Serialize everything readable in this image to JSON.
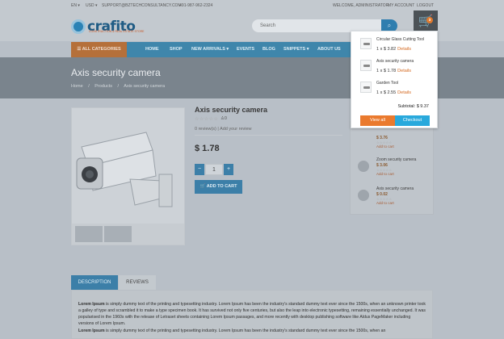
{
  "topbar": {
    "lang": "EN ▾",
    "currency": "USD ▾",
    "email": "SUPPORT@BZTECHCONSULTANCY.COM",
    "phone": "+91-987-962-2324",
    "welcome": "WELCOME, ADMINISTRATOR",
    "my_account": "MY ACCOUNT",
    "logout": "LOGOUT"
  },
  "header": {
    "logo": "crafito",
    "tagline": "CONSTRUCTION & REAL ESTATE STORE",
    "search_placeholder": "Search"
  },
  "nav": {
    "all_categories": "☰ ALL CATEGORIES",
    "items": [
      "HOME",
      "SHOP",
      "NEW ARRIVALS ▾",
      "EVENTS",
      "BLOG",
      "SNIPPETS ▾",
      "ABOUT US"
    ]
  },
  "banner": {
    "title": "Axis security camera",
    "crumbs": [
      "Home",
      "/",
      "Products",
      "/",
      "Axis security camera"
    ]
  },
  "product": {
    "title": "Axis security camera",
    "stars": "☆☆☆☆☆",
    "likes": "♙0",
    "reviews": "0 review(s) | Add your review",
    "price": "$ 1.78",
    "qty": "1",
    "qty_minus": "−",
    "qty_plus": "+",
    "add_to_cart": "🛒 ADD TO CART"
  },
  "sidebar": {
    "items": [
      {
        "name": "",
        "price": "$ 3.76",
        "stars": "☆☆☆☆☆",
        "add": "Add to cart"
      },
      {
        "name": "Zoom security camera",
        "price": "$ 3.06",
        "stars": "☆☆☆☆☆",
        "add": "Add to cart"
      },
      {
        "name": "Axis security camera",
        "price": "$ 0.02",
        "stars": "☆☆☆☆☆",
        "add": "Add to cart"
      }
    ]
  },
  "tabs": {
    "description": "DESCRIPTION",
    "reviews": "REVIEWS"
  },
  "description": {
    "lead1": "Lorem Ipsum",
    "text1": " is simply dummy text of the printing and typesetting industry. Lorem Ipsum has been the industry's standard dummy text ever since the 1500s, when an unknown printer took a galley of type and scrambled it to make a type specimen book. It has survived not only five centuries, but also the leap into electronic typesetting, remaining essentially unchanged. It was popularised in the 1960s with the release of Letraset sheets containing Lorem Ipsum passages, and more recently with desktop publishing software like Aldus PageMaker including versions of Lorem Ipsum.",
    "lead2": "Lorem Ipsum",
    "text2": " is simply dummy text of the printing and typesetting industry. Lorem Ipsum has been the industry's standard dummy text ever since the 1500s, when an"
  },
  "cart": {
    "count": "3",
    "items": [
      {
        "name": "Circular Glass Cutting Tool",
        "qty_price": "1 x $ 3.82",
        "details": "Details"
      },
      {
        "name": "Axis security camera",
        "qty_price": "1 x $ 1.78",
        "details": "Details"
      },
      {
        "name": "Garden Tool",
        "qty_price": "1 x $ 2.55",
        "details": "Details"
      }
    ],
    "subtotal_label": "Subtotal:",
    "subtotal": "$ 9.37",
    "view_all": "View all",
    "checkout": "Checkout",
    "remove": "✕"
  }
}
